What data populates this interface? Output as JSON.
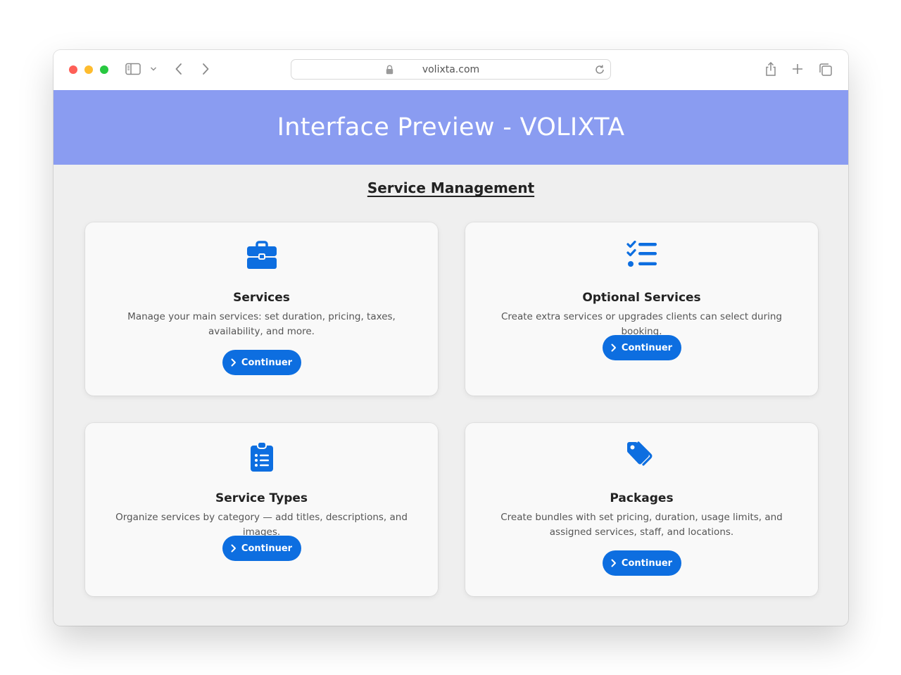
{
  "browser": {
    "url": "volixta.com",
    "icons": [
      "sidebar-icon",
      "chevron-down-icon",
      "back-icon",
      "forward-icon",
      "lock-icon",
      "reload-icon",
      "share-icon",
      "new-tab-icon",
      "tabs-overview-icon"
    ]
  },
  "header": {
    "title": "Interface Preview - VOLIXTA",
    "background": "#8a9cf1"
  },
  "main": {
    "section_title": "Service Management",
    "accent": "#0d6ee0",
    "cards": [
      {
        "icon": "briefcase-icon",
        "title": "Services",
        "description": "Manage your main services: set duration, pricing, taxes, availability, and more.",
        "button": "Continuer"
      },
      {
        "icon": "checklist-icon",
        "title": "Optional Services",
        "description": "Create extra services or upgrades clients can select during booking.",
        "button": "Continuer"
      },
      {
        "icon": "clipboard-list-icon",
        "title": "Service Types",
        "description": "Organize services by category — add titles, descriptions, and images.",
        "button": "Continuer"
      },
      {
        "icon": "tags-icon",
        "title": "Packages",
        "description": "Create bundles with set pricing, duration, usage limits, and assigned services, staff, and locations.",
        "button": "Continuer"
      }
    ]
  }
}
